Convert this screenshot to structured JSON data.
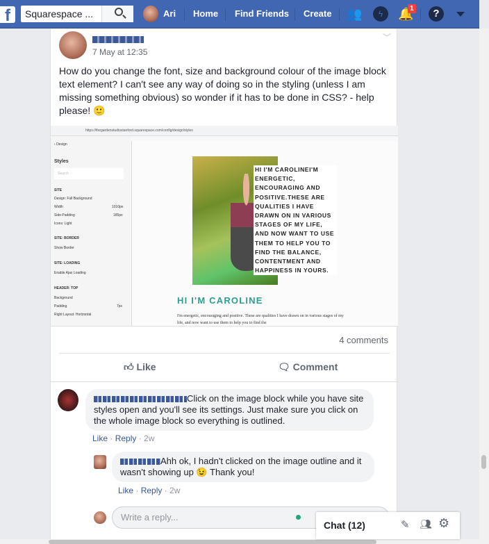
{
  "topbar": {
    "search_value": "Squarespace ...",
    "user": "Ari",
    "nav": [
      "Home",
      "Find Friends",
      "Create"
    ],
    "notification_count": "1",
    "brand_color": "#4267b2"
  },
  "post": {
    "author": "Jo H.....",
    "timestamp": "7 May at 12:35",
    "text": "How do you change the font, size and background colour of the image block text element? I can't see any way of doing so in the styling (unless I am missing something obvious) so wonder if it has to be done in CSS? - help please! 🙂",
    "screenshot": {
      "url": "https://thegardenstudiostanford.squarespace.com/config/design/styles",
      "back": "Design",
      "panel_title": "Styles",
      "search_placeholder": "Search",
      "settings": [
        {
          "label": "SITE"
        },
        {
          "label": "Design: Full Background"
        },
        {
          "label": "Width",
          "value": "1010px"
        },
        {
          "label": "Side Padding",
          "value": "185px"
        },
        {
          "label": "Icons: Light"
        },
        {
          "label": "SITE: BORDER"
        },
        {
          "label": "Show Border"
        },
        {
          "label": "SITE: LOADING"
        },
        {
          "label": "Enable Ajax Loading"
        },
        {
          "label": "HEADER: TOP"
        },
        {
          "label": "Background"
        },
        {
          "label": "Padding",
          "value": "7px"
        },
        {
          "label": "Right Layout: Horizontal"
        }
      ],
      "overlay_text": "HI I'M CAROLINEI'M ENERGETIC, ENCOURAGING AND POSITIVE.THESE ARE QUALITIES I HAVE DRAWN ON IN VARIOUS STAGES OF MY LIFE, AND NOW WANT TO USE THEM TO HELP YOU TO FIND THE BALANCE, CONTENTMENT AND HAPPINESS IN YOURS.",
      "heading": "HI I'M CAROLINE",
      "body": "I'm energetic, encouraging and positive.  These are qualities I have drawn on in various stages of my life, and now want to use them to help you to find the"
    },
    "comment_count": "4 comments",
    "like": "Like",
    "comment": "Comment"
  },
  "comments": [
    {
      "text": "Click on the image block while you have site styles open and you'll see its settings. Just make sure you click on the whole image block so everything is outlined.",
      "like": "Like",
      "reply": "Reply",
      "age": "2w"
    },
    {
      "text": "Ahh ok, I hadn't clicked on the image outline and it wasn't showing up 😉 Thank you!",
      "like": "Like",
      "reply": "Reply",
      "age": "2w"
    }
  ],
  "reply_placeholder": "Write a reply...",
  "chat": {
    "label": "Chat (12)"
  }
}
